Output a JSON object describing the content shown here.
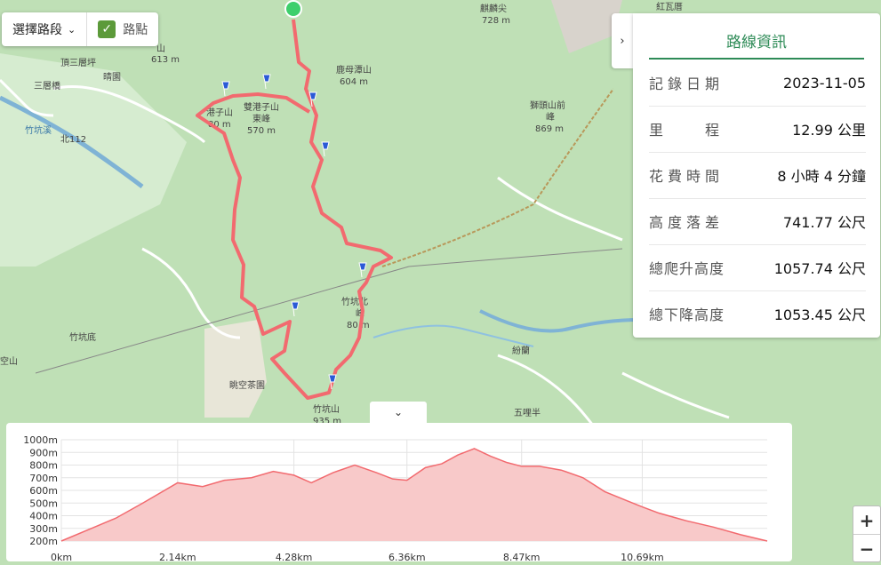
{
  "toolbar": {
    "segment_label": "選擇路段",
    "waypoint_label": "路點",
    "waypoint_checked": true
  },
  "map_labels": {
    "l1": "頂三層坪",
    "l2": "晴園",
    "l3": "北112",
    "l4": "竹坑溪",
    "l5": "三層橋",
    "l6": "竹坑底",
    "l7": "空山",
    "l8": "雙港子山",
    "l9": "570 m",
    "l10": "東峰",
    "l11": "鹿母潭山",
    "l12": "604 m",
    "l13": "麒麟尖",
    "l14": "728 m",
    "l15": "獅頭山前",
    "l16": "峰",
    "l17": "869 m",
    "l18": "竹坑北",
    "l19": "峰",
    "l20": "80 m",
    "l21": "竹坑山",
    "l22": "935 m",
    "l23": "眺空茶園",
    "l24": "五哩半",
    "l25": "紛蘭",
    "l26": "613 m",
    "l27": "山",
    "l28": "港子山",
    "l29": "80 m",
    "l30": "紅瓦厝"
  },
  "panel": {
    "title": "路線資訊",
    "rows": [
      {
        "label": "記錄日期",
        "value": "2023-11-05"
      },
      {
        "label": "里　　程",
        "value": "12.99 公里"
      },
      {
        "label": "花費時間",
        "value": "8 小時 4 分鐘"
      },
      {
        "label": "高度落差",
        "value": "741.77 公尺"
      },
      {
        "label": "總爬升高度",
        "value": "1057.74 公尺"
      },
      {
        "label": "總下降高度",
        "value": "1053.45 公尺"
      }
    ]
  },
  "colors": {
    "accent": "#2e8b57",
    "route": "#f26a6f",
    "profile_fill": "#f8c9c9",
    "map_bg": "#b9dcb2"
  },
  "icons": {
    "panel_toggle": "chevron-right-icon",
    "collapse": "chevron-down-icon",
    "dropdown": "chevron-down-icon"
  },
  "chart_data": {
    "type": "area",
    "ylabels": [
      "1000m",
      "900m",
      "800m",
      "700m",
      "600m",
      "500m",
      "400m",
      "300m",
      "200m"
    ],
    "xlabels": [
      "0km",
      "2.14km",
      "4.28km",
      "6.36km",
      "8.47km",
      "10.69km"
    ],
    "ylim": [
      200,
      1000
    ],
    "xlim": [
      0,
      12.99
    ],
    "x": [
      0,
      0.5,
      1.0,
      1.5,
      2.14,
      2.6,
      3.0,
      3.5,
      3.9,
      4.28,
      4.6,
      5.0,
      5.4,
      5.8,
      6.1,
      6.36,
      6.7,
      7.0,
      7.3,
      7.6,
      7.9,
      8.2,
      8.47,
      8.8,
      9.2,
      9.6,
      10.0,
      10.4,
      10.69,
      11.0,
      11.5,
      12.0,
      12.5,
      12.99
    ],
    "y": [
      200,
      290,
      380,
      500,
      660,
      630,
      680,
      700,
      750,
      720,
      660,
      740,
      800,
      740,
      690,
      680,
      780,
      810,
      880,
      930,
      870,
      820,
      790,
      790,
      760,
      700,
      590,
      520,
      470,
      420,
      360,
      310,
      250,
      200
    ]
  },
  "zoom": {
    "in": "+",
    "out": "−"
  }
}
